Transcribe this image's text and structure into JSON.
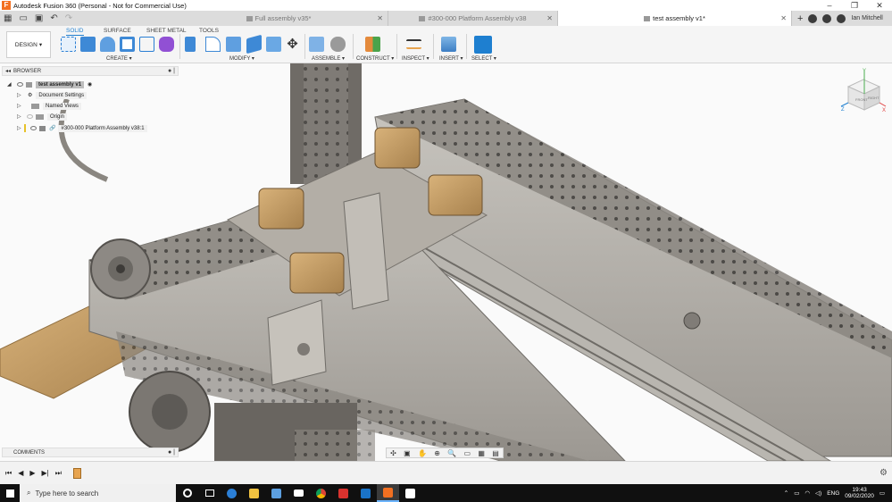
{
  "window": {
    "title": "Autodesk Fusion 360 (Personal - Not for Commercial Use)",
    "controls": [
      "–",
      "❐",
      "✕"
    ]
  },
  "tabs": [
    {
      "label": "Full assembly v35*",
      "active": false
    },
    {
      "label": "#300-000 Platform Assembly v38",
      "active": false
    },
    {
      "label": "test assembly v1*",
      "active": true
    }
  ],
  "user": {
    "name": "Ian Mitchell"
  },
  "ribbon": {
    "workspace": "DESIGN",
    "tabs": [
      "SOLID",
      "SURFACE",
      "SHEET METAL",
      "TOOLS"
    ],
    "groups": [
      "CREATE",
      "MODIFY",
      "ASSEMBLE",
      "CONSTRUCT",
      "INSPECT",
      "INSERT",
      "SELECT"
    ]
  },
  "browser": {
    "title": "BROWSER",
    "items": [
      {
        "label": "test assembly v1",
        "root": true
      },
      {
        "label": "Document Settings"
      },
      {
        "label": "Named Views"
      },
      {
        "label": "Origin"
      },
      {
        "label": "#300-000 Platform Assembly v38:1"
      }
    ]
  },
  "comments": {
    "title": "COMMENTS"
  },
  "viewcube": {
    "face": "FRONT",
    "side": "RIGHT",
    "axis_x": "X",
    "axis_y": "Y",
    "axis_z": "Z"
  },
  "taskbar": {
    "search_placeholder": "Type here to search",
    "language": "ENG",
    "time": "19:43",
    "date": "09/02/2020"
  },
  "colors": {
    "accent": "#1e7fd0",
    "fusion_orange": "#f37021",
    "metal": "#a8a39c",
    "wood": "#c8a36e"
  }
}
